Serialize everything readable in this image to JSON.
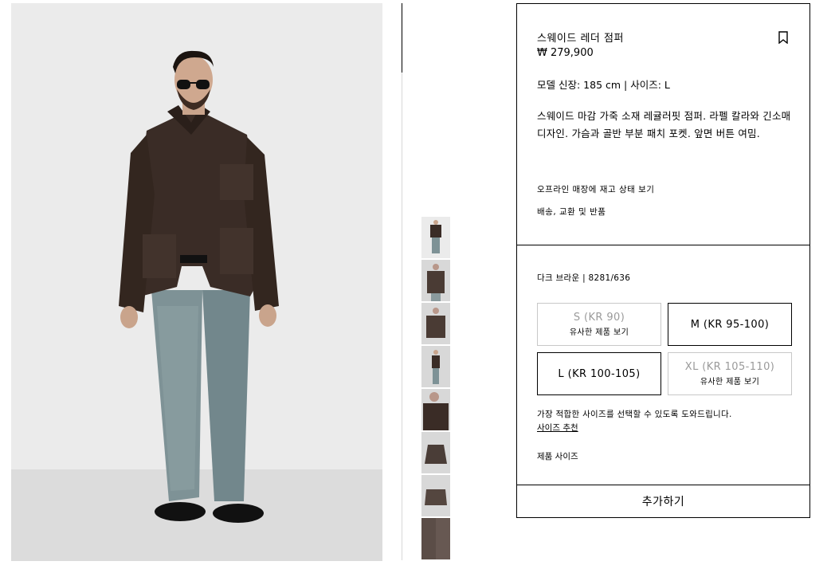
{
  "product": {
    "title": "스웨이드 레더 점퍼",
    "price": "₩ 279,900",
    "model_info": "모델 신장: 185 cm | 사이즈: L",
    "description": "스웨이드 마감 가죽 소재 레귤러핏 점퍼. 라펠 칼라와 긴소매 디자인. 가슴과 골반 부분 패치 포켓. 앞면 버튼 여밈.",
    "store_stock_link": "오프라인 매장에 재고 상태 보기",
    "shipping_link": "배송, 교환 및 반품"
  },
  "selection": {
    "color_ref": "다크 브라운 | 8281/636",
    "sizes": [
      {
        "label": "S (KR 90)",
        "note": "유사한 제품 보기",
        "available": false
      },
      {
        "label": "M (KR 95-100)",
        "note": "",
        "available": true
      },
      {
        "label": "L (KR 100-105)",
        "note": "",
        "available": true
      },
      {
        "label": "XL (KR 105-110)",
        "note": "유사한 제품 보기",
        "available": false
      }
    ],
    "help_text": "가장 적합한 사이즈를 선택할 수 있도록 도와드립니다.",
    "recommend_link": "사이즈 추천",
    "product_sizes_link": "제품 사이즈"
  },
  "add_button": "추가하기",
  "icons": {
    "bookmark": "bookmark-icon"
  },
  "thumbnails": [
    "full-look",
    "jacket-front-model",
    "jacket-model-close",
    "side-view",
    "detail-close",
    "jacket-flat-front",
    "jacket-flat-folded",
    "jacket-fabric-detail"
  ]
}
